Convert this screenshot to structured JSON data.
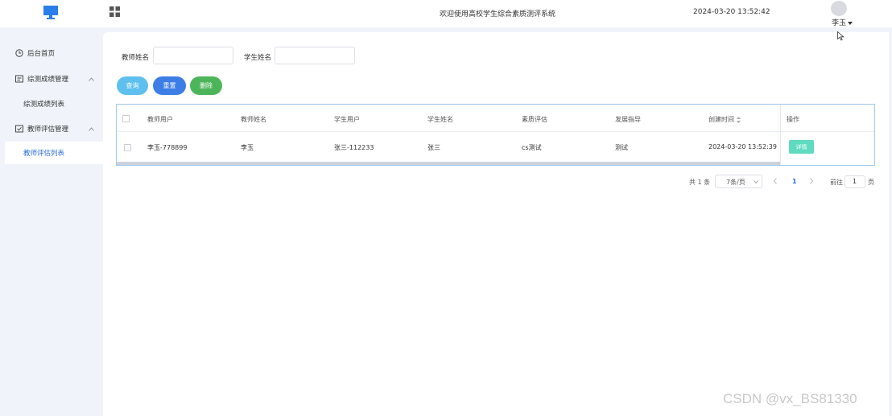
{
  "header": {
    "title": "欢迎使用高校学生综合素质测评系统",
    "datetime": "2024-03-20 13:52:42",
    "username": "李玉"
  },
  "sidebar": {
    "items": [
      {
        "label": "后台首页",
        "icon": "clock-icon"
      },
      {
        "label": "综测成绩管理",
        "icon": "form-icon",
        "expanded": true,
        "children": [
          {
            "label": "综测成绩列表"
          }
        ]
      },
      {
        "label": "教师评估管理",
        "icon": "check-square-icon",
        "expanded": true,
        "children": [
          {
            "label": "教师评估列表",
            "active": true
          }
        ]
      }
    ]
  },
  "search": {
    "teacher_name_label": "教师姓名",
    "teacher_name_value": "",
    "student_name_label": "学生姓名",
    "student_name_value": ""
  },
  "toolbar": {
    "query_label": "查询",
    "reset_label": "重置",
    "delete_label": "删除"
  },
  "table": {
    "columns": [
      "教师用户",
      "教师姓名",
      "学生用户",
      "学生姓名",
      "素质评估",
      "发展指导",
      "创建时间",
      "操作"
    ],
    "rows": [
      {
        "teacher_user": "李玉-778899",
        "teacher_name": "李玉",
        "student_user": "张三-112233",
        "student_name": "张三",
        "assessment": "cs测试",
        "guidance": "测试",
        "created_at": "2024-03-20 13:52:39",
        "action": "详情"
      }
    ]
  },
  "pagination": {
    "total_text": "共 1 条",
    "page_size": "7条/页",
    "current_page": "1",
    "goto_prefix": "前往",
    "goto_value": "1",
    "goto_suffix": "页"
  },
  "watermark": "CSDN @vx_BS81330",
  "colors": {
    "accent": "#2b6de0",
    "query": "#5ec0ef",
    "reset": "#3d7ee6",
    "delete": "#4cb55a",
    "detail": "#5fdbbf"
  }
}
